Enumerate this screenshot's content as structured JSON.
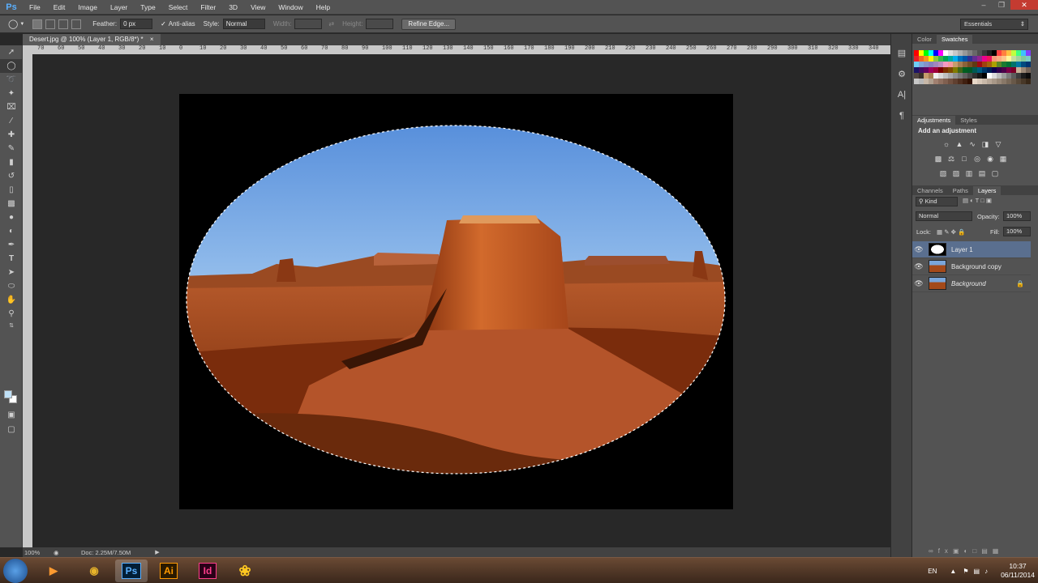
{
  "app": {
    "logo": "Ps"
  },
  "menu": [
    "File",
    "Edit",
    "Image",
    "Layer",
    "Type",
    "Select",
    "Filter",
    "3D",
    "View",
    "Window",
    "Help"
  ],
  "options": {
    "feather_label": "Feather:",
    "feather_value": "0 px",
    "antialias_label": "Anti-alias",
    "style_label": "Style:",
    "style_value": "Normal",
    "width_label": "Width:",
    "height_label": "Height:",
    "refine_edge": "Refine Edge...",
    "workspace": "Essentials"
  },
  "document": {
    "tab_title": "Desert.jpg @ 100% (Layer 1, RGB/8*) *"
  },
  "ruler": {
    "top_ticks": [
      "70",
      "60",
      "50",
      "40",
      "30",
      "20",
      "10",
      "0",
      "10",
      "20",
      "30",
      "40",
      "50",
      "60",
      "70",
      "80",
      "90",
      "100",
      "110",
      "120",
      "130",
      "140",
      "150",
      "160",
      "170",
      "180",
      "190",
      "200",
      "210",
      "220",
      "230",
      "240",
      "250",
      "260",
      "270",
      "280",
      "290",
      "300",
      "310",
      "320",
      "330",
      "340"
    ]
  },
  "status": {
    "zoom": "100%",
    "doc": "Doc: 2.25M/7.50M"
  },
  "panels": {
    "color_tab": "Color",
    "swatches_tab": "Swatches",
    "adjustments_tab": "Adjustments",
    "styles_tab": "Styles",
    "add_adjustment": "Add an adjustment",
    "channels_tab": "Channels",
    "paths_tab": "Paths",
    "layers_tab": "Layers",
    "kind": "Kind",
    "blend_mode": "Normal",
    "opacity_label": "Opacity:",
    "opacity_value": "100%",
    "lock_label": "Lock:",
    "fill_label": "Fill:",
    "fill_value": "100%"
  },
  "layers": [
    {
      "name": "Layer 1",
      "selected": true,
      "locked": false
    },
    {
      "name": "Background copy",
      "selected": false,
      "locked": false
    },
    {
      "name": "Background",
      "selected": false,
      "locked": true
    }
  ],
  "taskbar": {
    "apps": [
      "Media Player",
      "Chrome",
      "Ps",
      "Ai",
      "Id",
      "Pinwheel"
    ],
    "language": "EN",
    "time": "10:37",
    "date": "06/11/2014"
  },
  "colors": {
    "accent": "#5a6f8f",
    "ps_blue": "#5ab0ff",
    "ai_orange": "#ff9a00",
    "id_pink": "#ff3d8a",
    "foreground": "#bfe0f6",
    "background": "#ffffff"
  }
}
